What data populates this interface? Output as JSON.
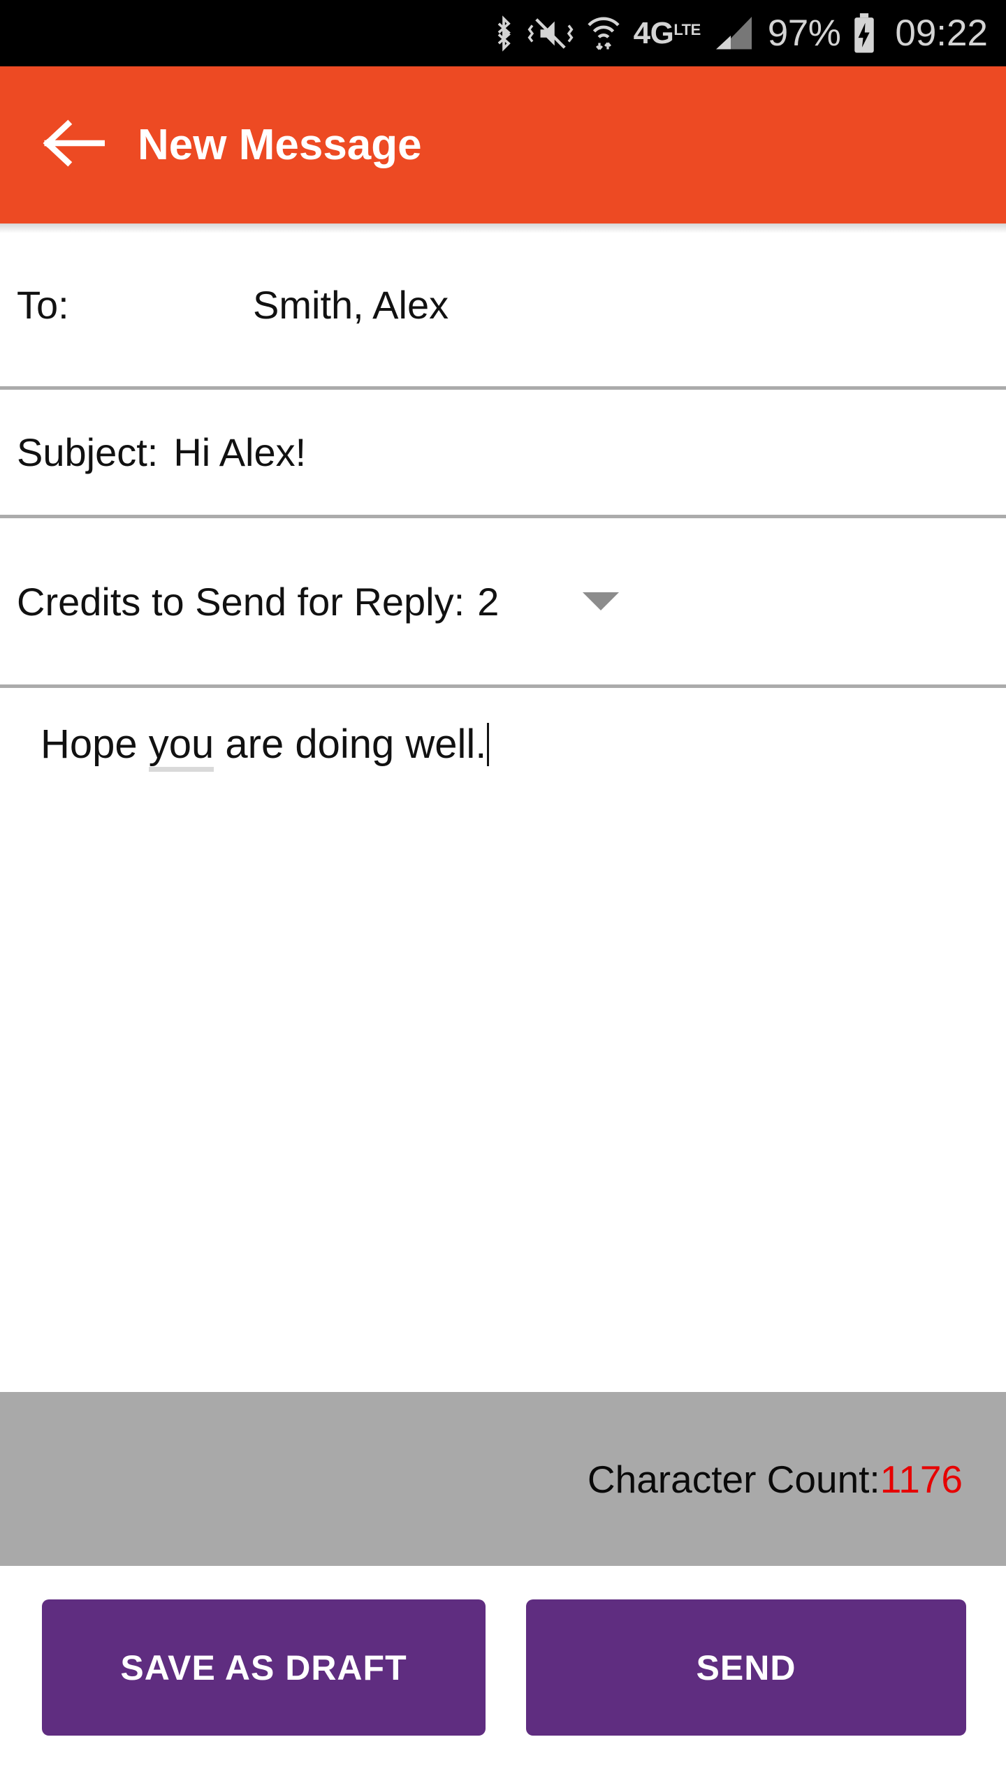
{
  "status_bar": {
    "icons": [
      "bluetooth-icon",
      "vibrate-mute-icon",
      "wifi-icon",
      "4g-lte-icon",
      "signal-bars-icon"
    ],
    "network_label": "4G",
    "network_sub": "LTE",
    "battery_percent": "97%",
    "battery_state_icon": "battery-charging-icon",
    "clock": "09:22"
  },
  "app_bar": {
    "back_icon": "arrow-left-icon",
    "title": "New Message"
  },
  "form": {
    "to": {
      "label": "To:",
      "value": "Smith, Alex"
    },
    "subject": {
      "label": "Subject:",
      "value": "Hi Alex!"
    },
    "credits": {
      "label": "Credits to Send for Reply:",
      "value": "2",
      "dropdown_icon": "chevron-down-icon"
    }
  },
  "body": {
    "text_before": "Hope ",
    "text_misspelled": "you",
    "text_after": " are doing well."
  },
  "char_count": {
    "label": "Character Count:",
    "value": "1176",
    "value_color": "#e60000",
    "bar_color": "#a9a9a9"
  },
  "actions": {
    "save_draft_label": "SAVE AS DRAFT",
    "send_label": "SEND",
    "button_color": "#5F2D80"
  },
  "theme": {
    "app_bar_color": "#ED4A23",
    "divider_color": "#ababab",
    "status_bar_color": "#000000"
  }
}
